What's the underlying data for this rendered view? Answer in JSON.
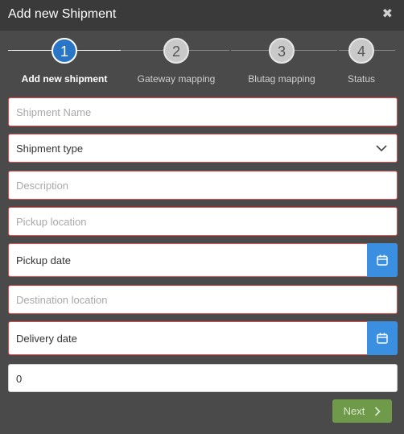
{
  "dialog": {
    "title": "Add new Shipment",
    "close_symbol": "✖"
  },
  "stepper": {
    "steps": [
      {
        "number": "1",
        "label": "Add new shipment",
        "state": "active"
      },
      {
        "number": "2",
        "label": "Gateway mapping",
        "state": "inactive"
      },
      {
        "number": "3",
        "label": "Blutag mapping",
        "state": "inactive"
      },
      {
        "number": "4",
        "label": "Status",
        "state": "inactive"
      }
    ]
  },
  "form": {
    "shipment_name": {
      "placeholder": "Shipment Name",
      "value": ""
    },
    "shipment_type": {
      "selected": "Shipment type"
    },
    "description": {
      "placeholder": "Description",
      "value": ""
    },
    "pickup_location": {
      "placeholder": "Pickup location",
      "value": ""
    },
    "pickup_date": {
      "label": "Pickup date"
    },
    "destination_location": {
      "placeholder": "Destination location",
      "value": ""
    },
    "delivery_date": {
      "label": "Delivery date"
    },
    "quantity": {
      "value": "0"
    }
  },
  "footer": {
    "next_label": "Next"
  },
  "colors": {
    "header_bg": "#3a3a3a",
    "body_bg": "#4a4a4a",
    "active_step": "#2a76c6",
    "error_border": "#e04b4b",
    "calendar_button": "#3b8fe0",
    "next_button": "#6e9a4a"
  },
  "icons": {
    "close": "close-icon",
    "chevron": "chevron-down-icon",
    "calendar": "calendar-icon",
    "next": "chevron-right-icon"
  }
}
